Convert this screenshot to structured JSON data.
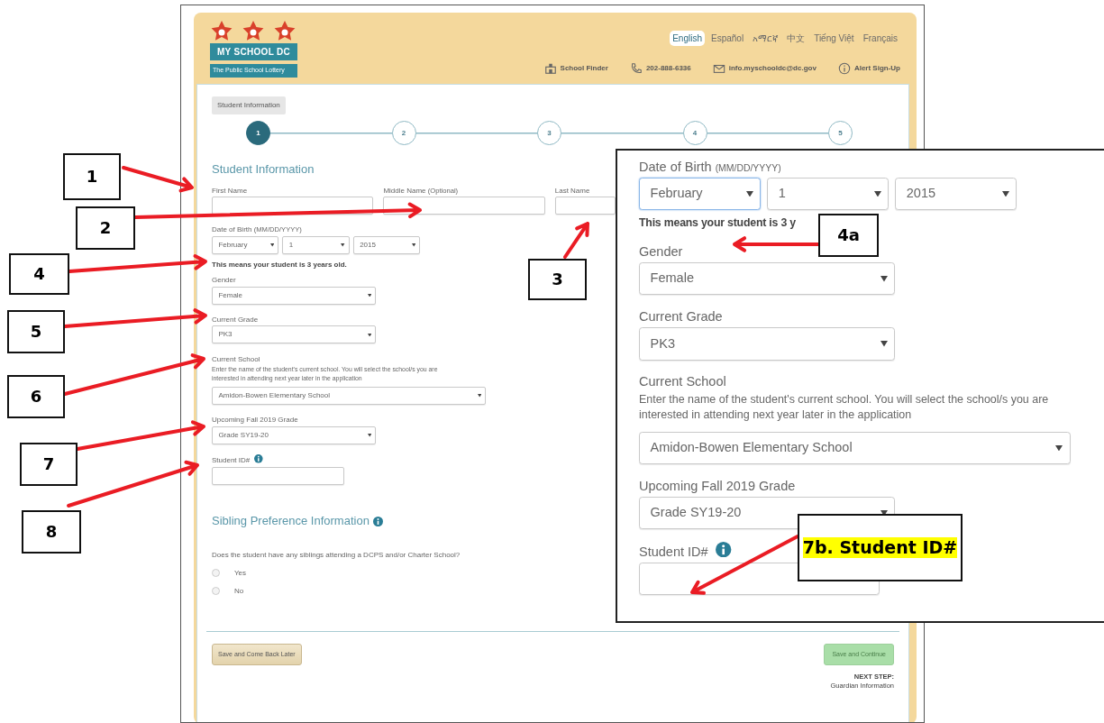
{
  "header": {
    "logo_title": "MY SCHOOL DC",
    "logo_tagline": "The Public School Lottery",
    "languages": [
      {
        "label": "English",
        "selected": true
      },
      {
        "label": "Español",
        "selected": false
      },
      {
        "label": "አማርኛ",
        "selected": false
      },
      {
        "label": "中文",
        "selected": false
      },
      {
        "label": "Tiếng Việt",
        "selected": false
      },
      {
        "label": "Français",
        "selected": false
      }
    ],
    "links": [
      {
        "kind": "finder",
        "label": "School Finder"
      },
      {
        "kind": "phone",
        "label": "202-888-6336"
      },
      {
        "kind": "email",
        "label": "info.myschooldc@dc.gov"
      },
      {
        "kind": "alert",
        "label": "Alert Sign-Up"
      }
    ]
  },
  "stepper": {
    "tooltip": "Student Information",
    "steps": [
      {
        "label": "1",
        "selected": true
      },
      {
        "label": "2",
        "selected": false
      },
      {
        "label": "3",
        "selected": false
      },
      {
        "label": "4",
        "selected": false
      },
      {
        "label": "5",
        "selected": false
      }
    ]
  },
  "form": {
    "heading": "Student Information",
    "fields": [
      {
        "kind": "name_row",
        "items": [
          {
            "label": "First Name"
          },
          {
            "label": "Middle Name",
            "note": "(Optional)"
          },
          {
            "label": "Last Name"
          }
        ]
      },
      {
        "kind": "date",
        "label": "Date of Birth",
        "note": "(MM/DD/YYYY)",
        "parts": [
          {
            "value": "February",
            "focused": false
          },
          {
            "value": "1",
            "focused": false
          },
          {
            "value": "2015",
            "focused": false
          }
        ]
      },
      {
        "kind": "message",
        "text": "This means your student is 3 years old."
      },
      {
        "kind": "select",
        "label": "Gender",
        "value": "Female",
        "wide": false
      },
      {
        "kind": "select",
        "label": "Current Grade",
        "value": "PK3",
        "wide": false
      },
      {
        "kind": "select",
        "label": "Current School",
        "help": "Enter the name of the student's current school. You will select the school/s you are interested in attending next year later in the application",
        "value": "Amidon-Bowen Elementary School",
        "wide": true
      },
      {
        "kind": "select",
        "label": "Upcoming Fall 2019 Grade",
        "value": "Grade SY19-20",
        "wide": false
      },
      {
        "kind": "input",
        "label": "Student ID#",
        "info": true
      }
    ],
    "sibling": {
      "heading": "Sibling Preference Information",
      "question": "Does the student have any siblings attending a DCPS and/or Charter School?",
      "options": [
        {
          "label": "Yes",
          "selected": false
        },
        {
          "label": "No",
          "selected": false
        }
      ]
    }
  },
  "footer": {
    "save_later": "Save and Come Back Later",
    "save_continue": "Save and Continue",
    "next_step_label": "NEXT STEP:",
    "next_step": "Guardian Information"
  },
  "inset": {
    "fields": [
      {
        "kind": "date",
        "label": "Date of Birth",
        "note": "(MM/DD/YYYY)",
        "parts": [
          {
            "value": "February",
            "focused": true
          },
          {
            "value": "1",
            "focused": false
          },
          {
            "value": "2015",
            "focused": false
          }
        ]
      },
      {
        "kind": "message",
        "text": "This means your student is 3 y"
      },
      {
        "kind": "select",
        "label": "Gender",
        "value": "Female",
        "wide": false
      },
      {
        "kind": "select",
        "label": "Current Grade",
        "value": "PK3",
        "wide": false
      },
      {
        "kind": "select",
        "label": "Current School",
        "help": "Enter the name of the student's current school. You will select the school/s you are interested in attending next year later in the application",
        "value": "Amidon-Bowen Elementary School",
        "wide": true
      },
      {
        "kind": "select",
        "label": "Upcoming Fall 2019 Grade",
        "value": "Grade SY19-20",
        "wide": false
      },
      {
        "kind": "input",
        "label": "Student ID#",
        "info": true
      }
    ]
  },
  "callouts": [
    {
      "label": "1",
      "highlighted": false
    },
    {
      "label": "2",
      "highlighted": false
    },
    {
      "label": "3",
      "highlighted": false
    },
    {
      "label": "4",
      "highlighted": false
    },
    {
      "label": "4a",
      "highlighted": false
    },
    {
      "label": "5",
      "highlighted": false
    },
    {
      "label": "6",
      "highlighted": false
    },
    {
      "label": "7",
      "highlighted": false
    },
    {
      "label": "8",
      "highlighted": false
    },
    {
      "label": "7b. Student ID#",
      "highlighted": true
    }
  ]
}
